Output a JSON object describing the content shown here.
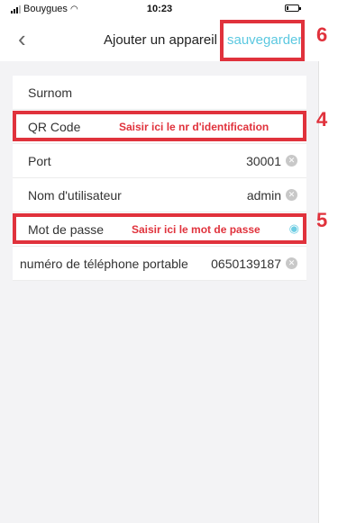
{
  "status_bar": {
    "carrier": "Bouygues",
    "time": "10:23"
  },
  "nav": {
    "title": "Ajouter un appareil",
    "save_label": "sauvegarder"
  },
  "form": {
    "rows": [
      {
        "label": "Surnom",
        "value": ""
      },
      {
        "label": "QR Code",
        "hint": "Saisir ici le nr d'identification"
      },
      {
        "label": "Port",
        "value": "30001"
      },
      {
        "label": "Nom d'utilisateur",
        "value": "admin"
      },
      {
        "label": "Mot de passe",
        "hint": "Saisir ici le mot de passe"
      },
      {
        "label": "numéro de téléphone portable",
        "value": "0650139187"
      }
    ]
  },
  "annotations": {
    "qr": "4",
    "password": "5",
    "save": "6"
  },
  "colors": {
    "accent": "#5bc8e0",
    "annotation": "#e0323c"
  }
}
